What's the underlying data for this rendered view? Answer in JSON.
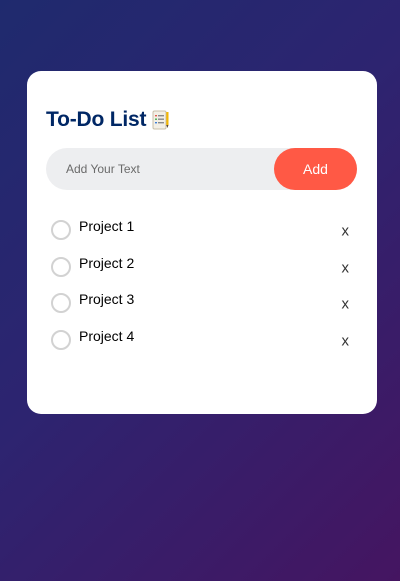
{
  "app": {
    "title": "To-Do List",
    "title_icon": "notepad-icon"
  },
  "input": {
    "placeholder": "Add Your Text",
    "value": ""
  },
  "add_button": {
    "label": "Add"
  },
  "colors": {
    "accent": "#ff5945",
    "title": "#002765",
    "card": "#ffffff",
    "input_bg": "#edeef0",
    "bg_gradient_start": "#1f2a6e",
    "bg_gradient_end": "#451561"
  },
  "items": [
    {
      "label": "Project 1",
      "remove_label": "x",
      "checked": false
    },
    {
      "label": "Project 2",
      "remove_label": "x",
      "checked": false
    },
    {
      "label": "Project 3",
      "remove_label": "x",
      "checked": false
    },
    {
      "label": "Project 4",
      "remove_label": "x",
      "checked": false
    }
  ]
}
